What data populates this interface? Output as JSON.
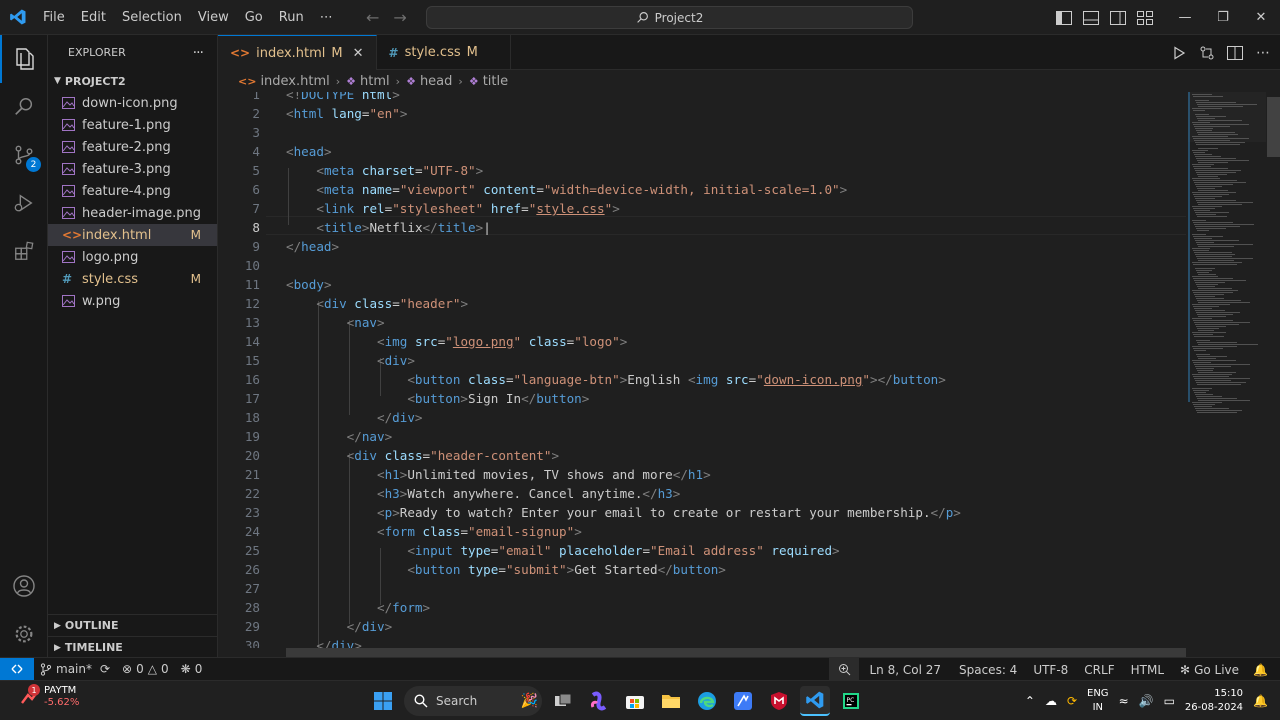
{
  "menu": [
    "File",
    "Edit",
    "Selection",
    "View",
    "Go",
    "Run",
    "⋯"
  ],
  "search": {
    "label": "Project2"
  },
  "explorer": {
    "title": "EXPLORER",
    "more": "···",
    "project": "PROJECT2",
    "files": [
      {
        "name": "down-icon.png",
        "type": "image",
        "mod": ""
      },
      {
        "name": "feature-1.png",
        "type": "image",
        "mod": ""
      },
      {
        "name": "feature-2.png",
        "type": "image",
        "mod": ""
      },
      {
        "name": "feature-3.png",
        "type": "image",
        "mod": ""
      },
      {
        "name": "feature-4.png",
        "type": "image",
        "mod": ""
      },
      {
        "name": "header-image.png",
        "type": "image",
        "mod": ""
      },
      {
        "name": "index.html",
        "type": "html",
        "mod": "M"
      },
      {
        "name": "logo.png",
        "type": "image",
        "mod": ""
      },
      {
        "name": "style.css",
        "type": "css",
        "mod": "M"
      },
      {
        "name": "w.png",
        "type": "image",
        "mod": ""
      }
    ],
    "outline": "OUTLINE",
    "timeline": "TIMELINE"
  },
  "source_control_badge": "2",
  "tabs": [
    {
      "label": "index.html",
      "mod": "M",
      "icon": "<>",
      "active": true
    },
    {
      "label": "style.css",
      "mod": "M",
      "icon": "#",
      "active": false
    }
  ],
  "breadcrumb": [
    "index.html",
    "html",
    "head",
    "title"
  ],
  "code_lines": [
    {
      "n": "1",
      "html": "<span class=\"p\">&lt;!</span><span class=\"t\">DOCTYPE</span> <span class=\"a\">html</span><span class=\"p\">&gt;</span>"
    },
    {
      "n": "2",
      "html": "<span class=\"p\">&lt;</span><span class=\"t\">html</span> <span class=\"a\">lang</span>=<span class=\"s\">\"en\"</span><span class=\"p\">&gt;</span>"
    },
    {
      "n": "3",
      "html": ""
    },
    {
      "n": "4",
      "html": "<span class=\"p\">&lt;</span><span class=\"t\">head</span><span class=\"p\">&gt;</span>"
    },
    {
      "n": "5",
      "html": "    <span class=\"p\">&lt;</span><span class=\"t\">meta</span> <span class=\"a\">charset</span>=<span class=\"s\">\"UTF-8\"</span><span class=\"p\">&gt;</span>"
    },
    {
      "n": "6",
      "html": "    <span class=\"p\">&lt;</span><span class=\"t\">meta</span> <span class=\"a\">name</span>=<span class=\"s\">\"viewport\"</span> <span class=\"a\">content</span>=<span class=\"s\">\"width=device-width, initial-scale=1.0\"</span><span class=\"p\">&gt;</span>"
    },
    {
      "n": "7",
      "html": "    <span class=\"p\">&lt;</span><span class=\"t\">link</span> <span class=\"a\">rel</span>=<span class=\"s\">\"stylesheet\"</span> <span class=\"a\">href</span>=<span class=\"s\">\"<span class=\"u\">style.css</span>\"</span><span class=\"p\">&gt;</span>"
    },
    {
      "n": "8",
      "html": "    <span class=\"p\">&lt;</span><span class=\"t\">title</span><span class=\"p\">&gt;</span>Netflix<span class=\"p\">&lt;/</span><span class=\"t\">title</span><span class=\"p\">&gt;</span>|"
    },
    {
      "n": "9",
      "html": "<span class=\"p\">&lt;/</span><span class=\"t\">head</span><span class=\"p\">&gt;</span>"
    },
    {
      "n": "10",
      "html": ""
    },
    {
      "n": "11",
      "html": "<span class=\"p\">&lt;</span><span class=\"t\">body</span><span class=\"p\">&gt;</span>"
    },
    {
      "n": "12",
      "html": "    <span class=\"p\">&lt;</span><span class=\"t\">div</span> <span class=\"a\">class</span>=<span class=\"s\">\"header\"</span><span class=\"p\">&gt;</span>"
    },
    {
      "n": "13",
      "html": "        <span class=\"p\">&lt;</span><span class=\"t\">nav</span><span class=\"p\">&gt;</span>"
    },
    {
      "n": "14",
      "html": "            <span class=\"p\">&lt;</span><span class=\"t\">img</span> <span class=\"a\">src</span>=<span class=\"s\">\"<span class=\"u\">logo.png</span>\"</span> <span class=\"a\">class</span>=<span class=\"s\">\"logo\"</span><span class=\"p\">&gt;</span>"
    },
    {
      "n": "15",
      "html": "            <span class=\"p\">&lt;</span><span class=\"t\">div</span><span class=\"p\">&gt;</span>"
    },
    {
      "n": "16",
      "html": "                <span class=\"p\">&lt;</span><span class=\"t\">button</span> <span class=\"a\">class</span>=<span class=\"s\">\"language-btn\"</span><span class=\"p\">&gt;</span>English <span class=\"p\">&lt;</span><span class=\"t\">img</span> <span class=\"a\">src</span>=<span class=\"s\">\"<span class=\"u\">down-icon.png</span>\"</span><span class=\"p\">&gt;&lt;/</span><span class=\"t\">button</span><span class=\"p\">&gt;</span>"
    },
    {
      "n": "17",
      "html": "                <span class=\"p\">&lt;</span><span class=\"t\">button</span><span class=\"p\">&gt;</span>Sign In<span class=\"p\">&lt;/</span><span class=\"t\">button</span><span class=\"p\">&gt;</span>"
    },
    {
      "n": "18",
      "html": "            <span class=\"p\">&lt;/</span><span class=\"t\">div</span><span class=\"p\">&gt;</span>"
    },
    {
      "n": "19",
      "html": "        <span class=\"p\">&lt;/</span><span class=\"t\">nav</span><span class=\"p\">&gt;</span>"
    },
    {
      "n": "20",
      "html": "        <span class=\"p\">&lt;</span><span class=\"t\">div</span> <span class=\"a\">class</span>=<span class=\"s\">\"header-content\"</span><span class=\"p\">&gt;</span>"
    },
    {
      "n": "21",
      "html": "            <span class=\"p\">&lt;</span><span class=\"t\">h1</span><span class=\"p\">&gt;</span>Unlimited movies, TV shows and more<span class=\"p\">&lt;/</span><span class=\"t\">h1</span><span class=\"p\">&gt;</span>"
    },
    {
      "n": "22",
      "html": "            <span class=\"p\">&lt;</span><span class=\"t\">h3</span><span class=\"p\">&gt;</span>Watch anywhere. Cancel anytime.<span class=\"p\">&lt;/</span><span class=\"t\">h3</span><span class=\"p\">&gt;</span>"
    },
    {
      "n": "23",
      "html": "            <span class=\"p\">&lt;</span><span class=\"t\">p</span><span class=\"p\">&gt;</span>Ready to watch? Enter your email to create or restart your membership.<span class=\"p\">&lt;/</span><span class=\"t\">p</span><span class=\"p\">&gt;</span>"
    },
    {
      "n": "24",
      "html": "            <span class=\"p\">&lt;</span><span class=\"t\">form</span> <span class=\"a\">class</span>=<span class=\"s\">\"email-signup\"</span><span class=\"p\">&gt;</span>"
    },
    {
      "n": "25",
      "html": "                <span class=\"p\">&lt;</span><span class=\"t\">input</span> <span class=\"a\">type</span>=<span class=\"s\">\"email\"</span> <span class=\"a\">placeholder</span>=<span class=\"s\">\"Email address\"</span> <span class=\"a\">required</span><span class=\"p\">&gt;</span>"
    },
    {
      "n": "26",
      "html": "                <span class=\"p\">&lt;</span><span class=\"t\">button</span> <span class=\"a\">type</span>=<span class=\"s\">\"submit\"</span><span class=\"p\">&gt;</span>Get Started<span class=\"p\">&lt;/</span><span class=\"t\">button</span><span class=\"p\">&gt;</span>"
    },
    {
      "n": "27",
      "html": ""
    },
    {
      "n": "28",
      "html": "            <span class=\"p\">&lt;/</span><span class=\"t\">form</span><span class=\"p\">&gt;</span>"
    },
    {
      "n": "29",
      "html": "        <span class=\"p\">&lt;/</span><span class=\"t\">div</span><span class=\"p\">&gt;</span>"
    },
    {
      "n": "30",
      "html": "    <span class=\"p\">&lt;/</span><span class=\"t\">div</span><span class=\"p\">&gt;</span>"
    }
  ],
  "current_line": "8",
  "status": {
    "branch": "main*",
    "errors": "0",
    "warnings": "0",
    "ports": "0",
    "position": "Ln 8, Col 27",
    "spaces": "Spaces: 4",
    "encoding": "UTF-8",
    "eol": "CRLF",
    "language": "HTML",
    "golive": "Go Live"
  },
  "taskbar": {
    "stock_badge": "1",
    "stock_name": "PAYTM",
    "stock_change": "-5.62%",
    "search": "Search",
    "lang_top": "ENG",
    "lang_bottom": "IN",
    "time": "15:10",
    "date": "26-08-2024"
  },
  "colors": {
    "accent": "#0078d4",
    "modified": "#e2c08d",
    "tag": "#569cd6",
    "attr": "#9cdcfe",
    "string": "#ce9178"
  }
}
